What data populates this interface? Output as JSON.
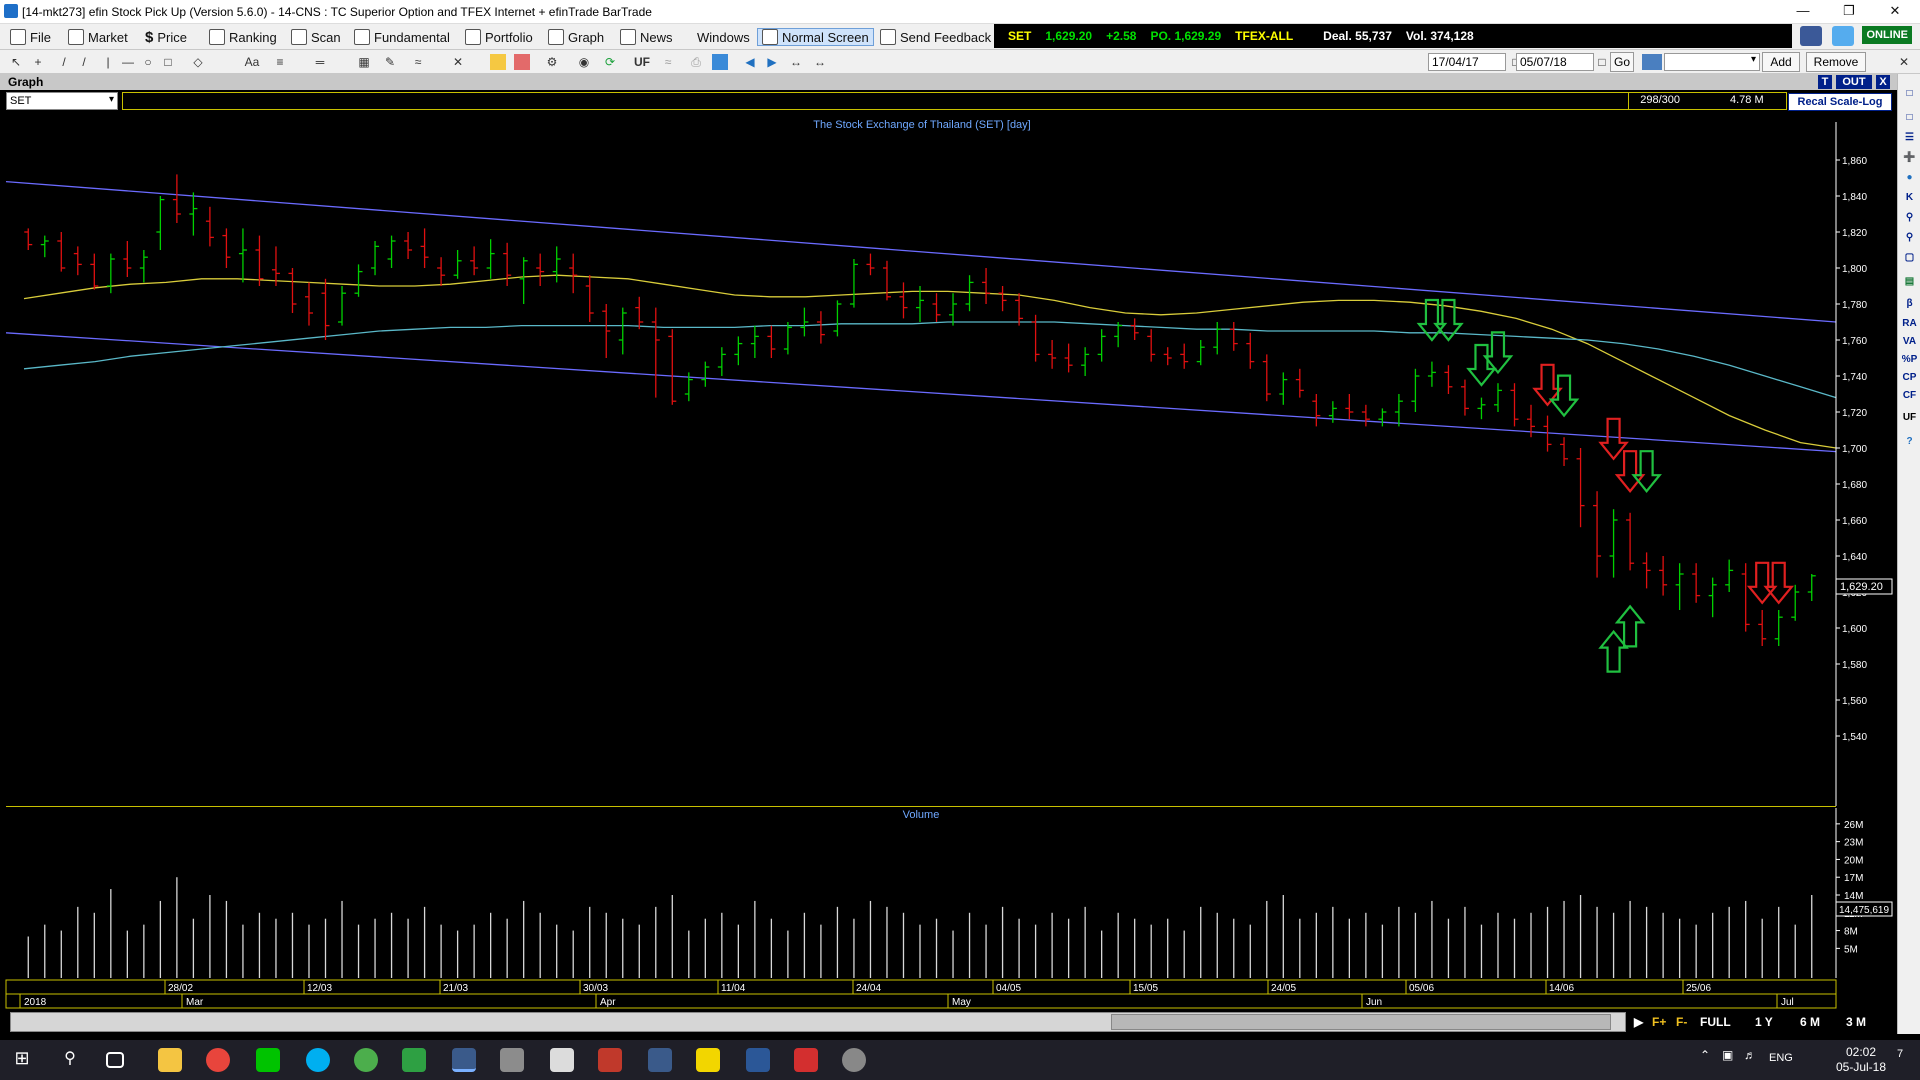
{
  "window": {
    "title": "[14-mkt273] efin Stock Pick Up (Version 5.6.0) - 14-CNS : TC Superior Option and TFEX Internet + efinTrade BarTrade"
  },
  "menu": [
    "File",
    "Market",
    "Price",
    "Ranking",
    "Scan",
    "Fundamental",
    "Portfolio",
    "Graph",
    "News",
    "Windows",
    "Normal Screen",
    "Send Feedback"
  ],
  "ticker": {
    "index": "SET",
    "last": "1,629.20",
    "change": "+2.58",
    "po": "PO. 1,629.29",
    "tfex": "TFEX-ALL",
    "deal": "Deal. 55,737",
    "vol": "Vol. 374,128"
  },
  "online": "ONLINE",
  "toolbar": {
    "date_from": "17/04/17",
    "date_to": "05/07/18",
    "go": "Go",
    "add": "Add",
    "remove": "Remove",
    "uf": "UF"
  },
  "panel": {
    "title": "Graph",
    "t_btn": "T",
    "out_btn": "OUT",
    "close_btn": "X",
    "symbol": "SET",
    "counter": "298/300",
    "volmax": "4.78 M",
    "recal": "Recal Scale-Log"
  },
  "chart": {
    "title": "The Stock Exchange of Thailand (SET) [day]",
    "volume_title": "Volume",
    "price_label": "1,629.20",
    "volume_label": "14,475,619"
  },
  "right_side": [
    "T",
    "OUT",
    "B",
    "RA",
    "VA",
    "%P",
    "CP",
    "CF",
    "UF"
  ],
  "range_buttons": [
    "FULL",
    "1 Y",
    "6 M",
    "3 M"
  ],
  "taskbar": {
    "lang": "ENG",
    "time": "02:02",
    "date": "05-Jul-18",
    "notif": "7"
  },
  "chart_data": {
    "type": "candlestick",
    "title": "The Stock Exchange of Thailand (SET) [day]",
    "ylim": [
      1520,
      1870
    ],
    "yticks": [
      1860,
      1840,
      1820,
      1800,
      1780,
      1760,
      1740,
      1720,
      1700,
      1680,
      1660,
      1640,
      1620,
      1600,
      1580,
      1560,
      1540
    ],
    "volume_ticks": [
      "26M",
      "23M",
      "20M",
      "17M",
      "14M",
      "11M",
      "8M",
      "5M"
    ],
    "date_ticks": [
      "28/02",
      "12/03",
      "21/03",
      "30/03",
      "11/04",
      "24/04",
      "04/05",
      "15/05",
      "24/05",
      "05/06",
      "14/06",
      "25/06"
    ],
    "month_labels": [
      "2018",
      "Mar",
      "Apr",
      "May",
      "Jun",
      "Jul"
    ],
    "bars": [
      [
        1820,
        1822,
        1810,
        1813,
        7
      ],
      [
        1813,
        1818,
        1806,
        1815,
        9
      ],
      [
        1815,
        1820,
        1798,
        1800,
        8
      ],
      [
        1808,
        1812,
        1796,
        1802,
        12
      ],
      [
        1802,
        1808,
        1788,
        1790,
        11
      ],
      [
        1790,
        1808,
        1786,
        1805,
        15
      ],
      [
        1805,
        1815,
        1795,
        1800,
        8
      ],
      [
        1800,
        1810,
        1792,
        1806,
        9
      ],
      [
        1820,
        1840,
        1810,
        1838,
        13
      ],
      [
        1838,
        1852,
        1825,
        1830,
        17
      ],
      [
        1830,
        1842,
        1818,
        1833,
        10
      ],
      [
        1826,
        1834,
        1812,
        1817,
        14
      ],
      [
        1818,
        1822,
        1800,
        1806,
        13
      ],
      [
        1808,
        1822,
        1792,
        1810,
        9
      ],
      [
        1810,
        1818,
        1790,
        1794,
        11
      ],
      [
        1799,
        1812,
        1790,
        1797,
        10
      ],
      [
        1797,
        1800,
        1775,
        1780,
        11
      ],
      [
        1784,
        1792,
        1768,
        1775,
        9
      ],
      [
        1786,
        1794,
        1760,
        1768,
        10
      ],
      [
        1770,
        1790,
        1768,
        1786,
        13
      ],
      [
        1786,
        1802,
        1784,
        1798,
        9
      ],
      [
        1800,
        1815,
        1796,
        1812,
        10
      ],
      [
        1805,
        1818,
        1800,
        1815,
        11
      ],
      [
        1815,
        1820,
        1805,
        1810,
        10
      ],
      [
        1812,
        1822,
        1800,
        1806,
        12
      ],
      [
        1800,
        1806,
        1790,
        1796,
        9
      ],
      [
        1796,
        1810,
        1794,
        1804,
        8
      ],
      [
        1804,
        1812,
        1796,
        1800,
        9
      ],
      [
        1800,
        1816,
        1794,
        1808,
        11
      ],
      [
        1808,
        1814,
        1790,
        1796,
        10
      ],
      [
        1794,
        1806,
        1780,
        1804,
        13
      ],
      [
        1800,
        1808,
        1790,
        1798,
        11
      ],
      [
        1798,
        1812,
        1792,
        1805,
        9
      ],
      [
        1800,
        1808,
        1786,
        1796,
        8
      ],
      [
        1790,
        1796,
        1770,
        1775,
        12
      ],
      [
        1776,
        1780,
        1750,
        1765,
        11
      ],
      [
        1760,
        1778,
        1752,
        1775,
        10
      ],
      [
        1778,
        1784,
        1766,
        1770,
        9
      ],
      [
        1770,
        1778,
        1728,
        1760,
        12
      ],
      [
        1762,
        1766,
        1724,
        1726,
        14
      ],
      [
        1730,
        1742,
        1726,
        1738,
        8
      ],
      [
        1738,
        1748,
        1734,
        1745,
        10
      ],
      [
        1745,
        1756,
        1740,
        1752,
        11
      ],
      [
        1752,
        1762,
        1746,
        1758,
        9
      ],
      [
        1758,
        1768,
        1750,
        1762,
        13
      ],
      [
        1762,
        1768,
        1750,
        1755,
        10
      ],
      [
        1755,
        1770,
        1752,
        1767,
        8
      ],
      [
        1767,
        1778,
        1762,
        1770,
        11
      ],
      [
        1770,
        1776,
        1758,
        1763,
        9
      ],
      [
        1765,
        1782,
        1762,
        1780,
        12
      ],
      [
        1780,
        1805,
        1778,
        1802,
        10
      ],
      [
        1802,
        1808,
        1796,
        1800,
        13
      ],
      [
        1800,
        1804,
        1782,
        1784,
        12
      ],
      [
        1784,
        1792,
        1772,
        1778,
        11
      ],
      [
        1778,
        1790,
        1770,
        1782,
        9
      ],
      [
        1780,
        1786,
        1770,
        1774,
        10
      ],
      [
        1774,
        1786,
        1768,
        1780,
        8
      ],
      [
        1780,
        1796,
        1776,
        1792,
        11
      ],
      [
        1792,
        1800,
        1780,
        1786,
        9
      ],
      [
        1786,
        1790,
        1776,
        1782,
        12
      ],
      [
        1782,
        1786,
        1768,
        1772,
        10
      ],
      [
        1770,
        1774,
        1748,
        1752,
        9
      ],
      [
        1752,
        1760,
        1744,
        1750,
        11
      ],
      [
        1750,
        1758,
        1742,
        1746,
        10
      ],
      [
        1746,
        1756,
        1740,
        1752,
        12
      ],
      [
        1752,
        1766,
        1748,
        1762,
        8
      ],
      [
        1762,
        1770,
        1756,
        1768,
        11
      ],
      [
        1768,
        1772,
        1760,
        1764,
        10
      ],
      [
        1762,
        1766,
        1748,
        1752,
        9
      ],
      [
        1752,
        1756,
        1746,
        1750,
        10
      ],
      [
        1752,
        1758,
        1744,
        1748,
        8
      ],
      [
        1748,
        1760,
        1746,
        1756,
        12
      ],
      [
        1756,
        1770,
        1752,
        1766,
        11
      ],
      [
        1766,
        1770,
        1754,
        1758,
        10
      ],
      [
        1758,
        1764,
        1744,
        1748,
        9
      ],
      [
        1748,
        1752,
        1726,
        1730,
        13
      ],
      [
        1730,
        1742,
        1724,
        1738,
        14
      ],
      [
        1738,
        1744,
        1728,
        1732,
        10
      ],
      [
        1726,
        1730,
        1712,
        1718,
        11
      ],
      [
        1718,
        1726,
        1714,
        1722,
        12
      ],
      [
        1722,
        1730,
        1716,
        1720,
        10
      ],
      [
        1720,
        1724,
        1712,
        1716,
        11
      ],
      [
        1716,
        1722,
        1712,
        1720,
        9
      ],
      [
        1720,
        1730,
        1712,
        1726,
        12
      ],
      [
        1726,
        1744,
        1720,
        1740,
        11
      ],
      [
        1740,
        1748,
        1734,
        1742,
        13
      ],
      [
        1742,
        1746,
        1730,
        1734,
        10
      ],
      [
        1734,
        1738,
        1718,
        1722,
        12
      ],
      [
        1722,
        1728,
        1716,
        1724,
        9
      ],
      [
        1724,
        1736,
        1720,
        1732,
        11
      ],
      [
        1732,
        1736,
        1712,
        1716,
        10
      ],
      [
        1716,
        1724,
        1706,
        1712,
        11
      ],
      [
        1712,
        1718,
        1698,
        1702,
        12
      ],
      [
        1702,
        1706,
        1690,
        1694,
        13
      ],
      [
        1694,
        1700,
        1656,
        1668,
        14
      ],
      [
        1668,
        1676,
        1628,
        1640,
        12
      ],
      [
        1640,
        1666,
        1628,
        1660,
        11
      ],
      [
        1660,
        1664,
        1632,
        1636,
        13
      ],
      [
        1636,
        1642,
        1622,
        1632,
        12
      ],
      [
        1632,
        1640,
        1618,
        1624,
        11
      ],
      [
        1624,
        1636,
        1610,
        1630,
        10
      ],
      [
        1630,
        1636,
        1614,
        1618,
        9
      ],
      [
        1618,
        1628,
        1606,
        1624,
        11
      ],
      [
        1624,
        1638,
        1620,
        1632,
        12
      ],
      [
        1630,
        1636,
        1598,
        1602,
        13
      ],
      [
        1602,
        1610,
        1590,
        1594,
        10
      ],
      [
        1594,
        1610,
        1590,
        1606,
        12
      ],
      [
        1606,
        1624,
        1604,
        1620,
        9
      ],
      [
        1620,
        1630,
        1615,
        1629,
        14
      ]
    ],
    "ma_yellow": [
      1783,
      1786,
      1789,
      1791,
      1792,
      1794,
      1794,
      1793,
      1792,
      1791,
      1790,
      1790,
      1791,
      1793,
      1795,
      1796,
      1795,
      1794,
      1791,
      1788,
      1785,
      1784,
      1784,
      1785,
      1786,
      1787,
      1787,
      1786,
      1785,
      1782,
      1778,
      1775,
      1774,
      1775,
      1777,
      1779,
      1781,
      1782,
      1782,
      1781,
      1779,
      1776,
      1772,
      1766,
      1758,
      1748,
      1738,
      1728,
      1718,
      1710,
      1703,
      1700
    ],
    "ma_cyan": [
      1744,
      1746,
      1748,
      1751,
      1753,
      1755,
      1757,
      1759,
      1761,
      1763,
      1765,
      1766,
      1767,
      1767,
      1768,
      1768,
      1768,
      1768,
      1767,
      1767,
      1767,
      1768,
      1768,
      1769,
      1769,
      1769,
      1770,
      1770,
      1770,
      1770,
      1769,
      1768,
      1767,
      1766,
      1766,
      1765,
      1765,
      1765,
      1765,
      1764,
      1764,
      1763,
      1762,
      1761,
      1760,
      1758,
      1755,
      1751,
      1746,
      1740,
      1734,
      1728
    ],
    "channel": {
      "upper": [
        1848,
        1770
      ],
      "lower": [
        1764,
        1698
      ]
    },
    "arrows": [
      {
        "bar": 85,
        "dir": "down",
        "color": "green",
        "price": 1760
      },
      {
        "bar": 86,
        "dir": "down",
        "color": "green",
        "price": 1760
      },
      {
        "bar": 88,
        "dir": "down",
        "color": "green",
        "price": 1735
      },
      {
        "bar": 89,
        "dir": "down",
        "color": "green",
        "price": 1742
      },
      {
        "bar": 92,
        "dir": "down",
        "color": "red",
        "price": 1724
      },
      {
        "bar": 93,
        "dir": "down",
        "color": "green",
        "price": 1718
      },
      {
        "bar": 96,
        "dir": "down",
        "color": "red",
        "price": 1694
      },
      {
        "bar": 97,
        "dir": "down",
        "color": "red",
        "price": 1676
      },
      {
        "bar": 98,
        "dir": "down",
        "color": "green",
        "price": 1676
      },
      {
        "bar": 96,
        "dir": "up",
        "color": "green",
        "price": 1598
      },
      {
        "bar": 97,
        "dir": "up",
        "color": "green",
        "price": 1612
      },
      {
        "bar": 105,
        "dir": "down",
        "color": "red",
        "price": 1614
      },
      {
        "bar": 106,
        "dir": "down",
        "color": "red",
        "price": 1614
      }
    ]
  }
}
